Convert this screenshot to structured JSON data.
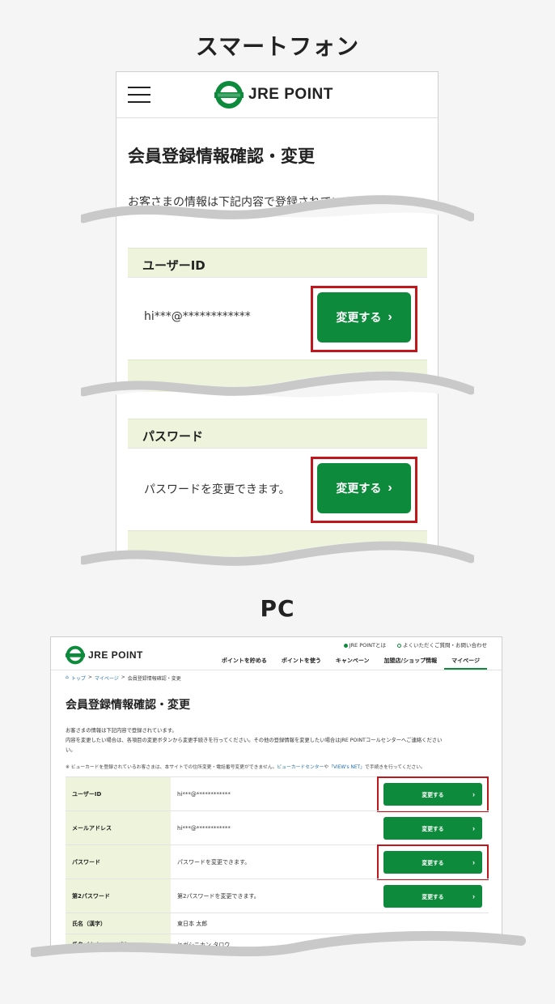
{
  "smartphone": {
    "heading": "スマートフォン",
    "logo_text": "JRE POINT",
    "page_title": "会員登録情報確認・変更",
    "description": "お客さまの情報は下記内容で登録されています。",
    "rows": [
      {
        "label": "ユーザーID",
        "value": "hi***@************",
        "button": "変更する"
      },
      {
        "label": "パスワード",
        "value": "パスワードを変更できます。",
        "button": "変更する"
      }
    ],
    "chevron": "›"
  },
  "pc": {
    "heading": "PC",
    "logo_text": "JRE POINT",
    "util_links": [
      "JRE POINTとは",
      "よくいただくご質問・お問い合わせ"
    ],
    "nav": [
      "ポイントを貯める",
      "ポイントを使う",
      "キャンペーン",
      "加盟店/ショップ情報",
      "マイページ"
    ],
    "breadcrumb": [
      "トップ",
      "マイページ",
      "会員登録情報確認・変更"
    ],
    "page_title": "会員登録情報確認・変更",
    "description_lines": [
      "お客さまの情報は下記内容で登録されています。",
      "内容を変更したい場合は、各項目の変更ボタンから変更手続きを行ってください。その他の登録情報を変更したい場合はJRE POINTコールセンターへご連絡ください",
      "い。"
    ],
    "note_prefix": "※ ビューカードを登録されているお客さまは、本サイトでの住所変更・電話番号変更ができません。",
    "note_link1": "ビューカードセンター",
    "note_mid": "や",
    "note_link2": "「VIEW's NET」",
    "note_suffix": "で手続きを行ってください。",
    "rows": [
      {
        "label": "ユーザーID",
        "value": "hi***@************",
        "button": "変更する"
      },
      {
        "label": "メールアドレス",
        "value": "hi***@************",
        "button": "変更する"
      },
      {
        "label": "パスワード",
        "value": "パスワードを変更できます。",
        "button": "変更する"
      },
      {
        "label": "第2パスワード",
        "value": "第2パスワードを変更できます。",
        "button": "変更する"
      },
      {
        "label": "氏名（漢字）",
        "value": "東日本 太郎",
        "button": ""
      },
      {
        "label": "氏名（カナ/ローマ字）",
        "value": "ヒガシニホン タロウ",
        "button": ""
      }
    ],
    "chevron": "›"
  },
  "colors": {
    "brand_green": "#0d8a3c",
    "highlight_red": "#c0161e",
    "label_bg": "#eef4dc"
  }
}
